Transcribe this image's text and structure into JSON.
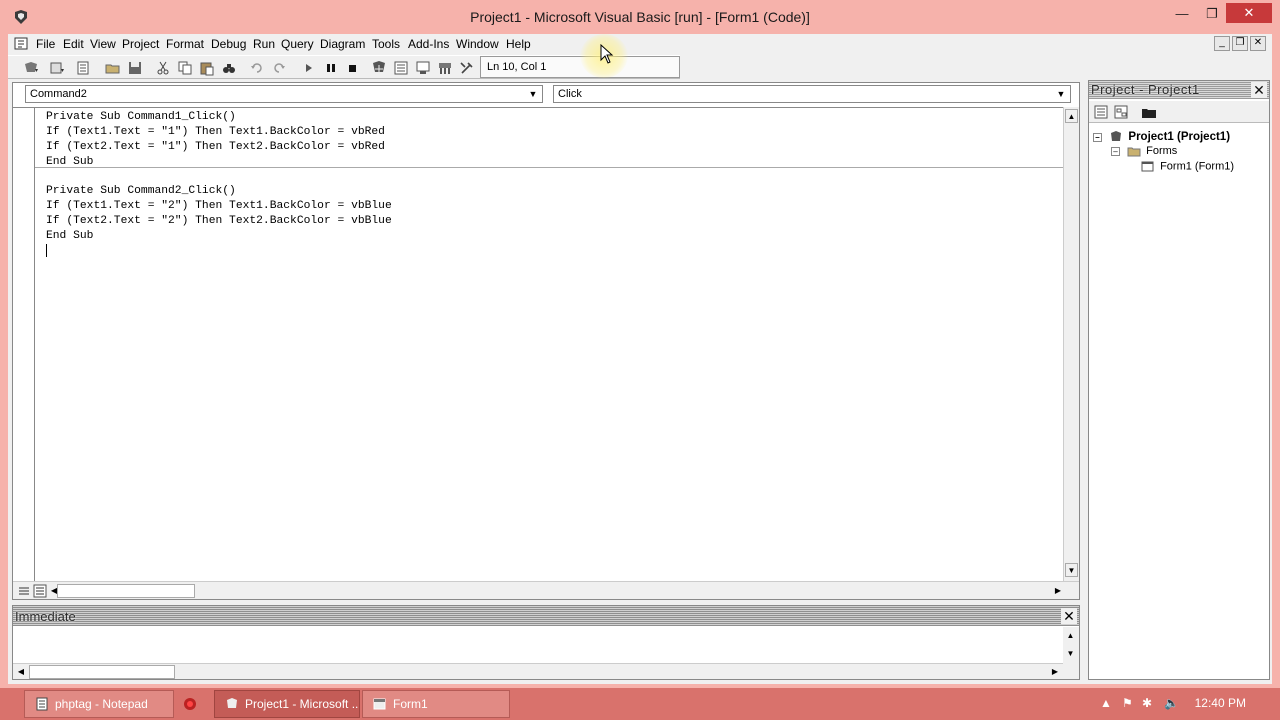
{
  "window": {
    "title": "Project1 - Microsoft Visual Basic [run] - [Form1 (Code)]"
  },
  "menu": {
    "items": [
      "File",
      "Edit",
      "View",
      "Project",
      "Format",
      "Debug",
      "Run",
      "Query",
      "Diagram",
      "Tools",
      "Add-Ins",
      "Window",
      "Help"
    ]
  },
  "toolbar": {
    "cursor_position": "Ln 10, Col 1"
  },
  "code_window": {
    "object_combo": "Command2",
    "procedure_combo": "Click",
    "lines": [
      "Private Sub Command1_Click()",
      "If (Text1.Text = \"1\") Then Text1.BackColor = vbRed",
      "If (Text2.Text = \"1\") Then Text2.BackColor = vbRed",
      "End Sub",
      "",
      "Private Sub Command2_Click()",
      "If (Text1.Text = \"2\") Then Text1.BackColor = vbBlue",
      "If (Text2.Text = \"2\") Then Text2.BackColor = vbBlue",
      "End Sub"
    ]
  },
  "project_explorer": {
    "title": "Project - Project1",
    "root": "Project1 (Project1)",
    "folder": "Forms",
    "item": "Form1 (Form1)"
  },
  "immediate": {
    "title": "Immediate"
  },
  "taskbar": {
    "buttons": [
      "phptag - Notepad",
      "Project1 - Microsoft ...",
      "Form1"
    ],
    "clock": "12:40 PM"
  },
  "colors": {
    "frame": "#f6b2ab",
    "taskbar": "#d9726c",
    "close_button": "#c7393a"
  }
}
